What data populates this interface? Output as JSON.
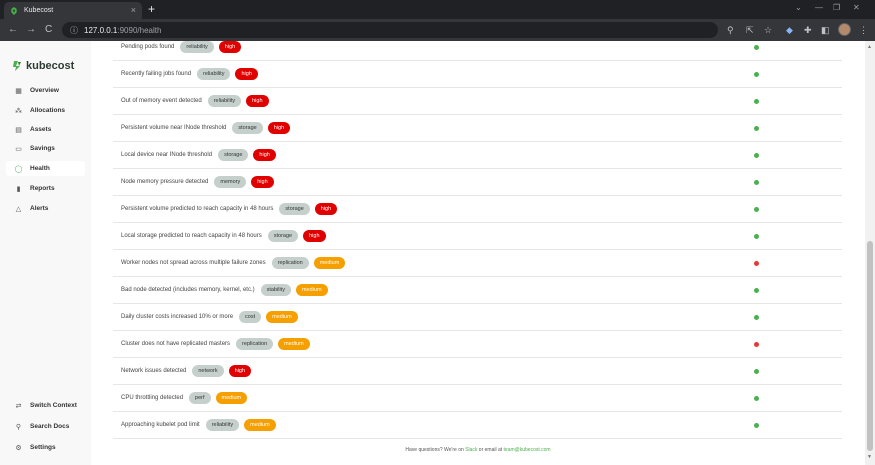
{
  "browser": {
    "tab_title": "Kubecost",
    "tab_close": "×",
    "new_tab": "+",
    "url_host": "127.0.0.1",
    "url_path": ":9090/health",
    "back": "←",
    "forward": "→",
    "reload": "C",
    "minimize": "—",
    "maximize": "❐",
    "close": "✕",
    "dropdown": "⌄"
  },
  "sidebar": {
    "brand": "kubecost",
    "items": [
      {
        "label": "Overview",
        "icon": "grid-icon",
        "glyph": "▦"
      },
      {
        "label": "Allocations",
        "icon": "nodes-icon",
        "glyph": "⁂"
      },
      {
        "label": "Assets",
        "icon": "assets-icon",
        "glyph": "▤"
      },
      {
        "label": "Savings",
        "icon": "savings-icon",
        "glyph": "▭"
      },
      {
        "label": "Health",
        "icon": "health-icon",
        "glyph": "◯"
      },
      {
        "label": "Reports",
        "icon": "bar-chart-icon",
        "glyph": "▮"
      },
      {
        "label": "Alerts",
        "icon": "bell-icon",
        "glyph": "△"
      }
    ],
    "bottom": [
      {
        "label": "Switch Context",
        "icon": "switch-icon",
        "glyph": "⇄"
      },
      {
        "label": "Search Docs",
        "icon": "search-icon",
        "glyph": "⚲"
      },
      {
        "label": "Settings",
        "icon": "gear-icon",
        "glyph": "⚙"
      }
    ]
  },
  "checks": [
    {
      "text": "Pending pods found",
      "category": "reliability",
      "severity": "high",
      "status": "pass"
    },
    {
      "text": "Recently failing jobs found",
      "category": "reliability",
      "severity": "high",
      "status": "pass"
    },
    {
      "text": "Out of memory event detected",
      "category": "reliability",
      "severity": "high",
      "status": "pass"
    },
    {
      "text": "Persistent volume near INode threshold",
      "category": "storage",
      "severity": "high",
      "status": "pass"
    },
    {
      "text": "Local device near INode threshold",
      "category": "storage",
      "severity": "high",
      "status": "pass"
    },
    {
      "text": "Node memory pressure detected",
      "category": "memory",
      "severity": "high",
      "status": "pass"
    },
    {
      "text": "Persistent volume predicted to reach capacity in 48 hours",
      "category": "storage",
      "severity": "high",
      "status": "pass"
    },
    {
      "text": "Local storage predicted to reach capacity in 48 hours",
      "category": "storage",
      "severity": "high",
      "status": "pass"
    },
    {
      "text": "Worker nodes not spread across multiple failure zones",
      "category": "replication",
      "severity": "medium",
      "status": "fail"
    },
    {
      "text": "Bad node detected (includes memory, kernel, etc.)",
      "category": "stability",
      "severity": "medium",
      "status": "pass"
    },
    {
      "text": "Daily cluster costs increased 10% or more",
      "category": "cost",
      "severity": "medium",
      "status": "pass"
    },
    {
      "text": "Cluster does not have replicated masters",
      "category": "replication",
      "severity": "medium",
      "status": "fail"
    },
    {
      "text": "Network issues detected",
      "category": "network",
      "severity": "high",
      "status": "pass"
    },
    {
      "text": "CPU throttling detected",
      "category": "perf",
      "severity": "medium",
      "status": "pass"
    },
    {
      "text": "Approaching kubelet pod limit",
      "category": "reliability",
      "severity": "medium",
      "status": "pass"
    }
  ],
  "footer": {
    "prefix": "Have questions? We're on ",
    "slack": "Slack",
    "middle": " or email at ",
    "email": "team@kubecost.com"
  },
  "colors": {
    "pass": "#4caf50",
    "fail": "#e53935",
    "high": "#e10000",
    "medium": "#f5a000",
    "brand": "#4caf50"
  }
}
